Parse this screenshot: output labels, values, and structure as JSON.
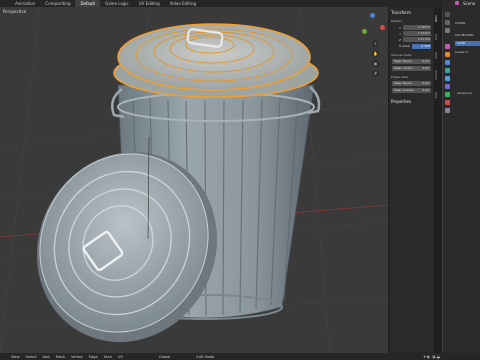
{
  "workspace_tabs": [
    "Animation",
    "Compositing",
    "Default",
    "Game Logic",
    "UV Editing",
    "Video Editing"
  ],
  "active_tab": "Default",
  "viewport": {
    "title": "Perspective",
    "nav_icons": [
      "zoom-icon",
      "hand-icon",
      "camera-icon",
      "grid-icon"
    ]
  },
  "scene": {
    "label": "Scene"
  },
  "npanel": {
    "transform_header": "Transform",
    "median_label": "Median:",
    "rows": [
      {
        "k": "X",
        "v": "0.18803"
      },
      {
        "k": "Y",
        "v": "0.33063"
      },
      {
        "k": "Z",
        "v": "0.97764"
      },
      {
        "k": "N Global",
        "v": "0.008"
      }
    ],
    "vertices_data_label": "Vertices Data:",
    "vertices_fields": [
      {
        "k": "Mean Bevel",
        "v": "0.00"
      },
      {
        "k": "Mean Vertex",
        "v": "0.00"
      }
    ],
    "edges_data_label": "Edges Data:",
    "edges_fields": [
      {
        "k": "Mean Bevel",
        "v": "0.00"
      },
      {
        "k": "Mean Crease",
        "v": "0.00"
      }
    ],
    "properties_header": "Properties"
  },
  "side_tabs": [
    "Item",
    "Tool",
    "View",
    "Create",
    "Edit"
  ],
  "properties_panel": {
    "object_name": "COVER",
    "add_modifier": "Add Modifier",
    "modifier_label": "SubD",
    "levels_label": "Levels Vi",
    "advanced_label": "Advanced"
  },
  "bottom_menu": [
    "View",
    "Select",
    "Add",
    "Mesh",
    "Vertex",
    "Edge",
    "Face",
    "UV"
  ],
  "bottom_right": [
    "Global",
    "Edit Mode"
  ],
  "colors": {
    "accent": "#4772b3",
    "selection_outline": "#f0a030",
    "mesh": "#8f9aa0"
  }
}
